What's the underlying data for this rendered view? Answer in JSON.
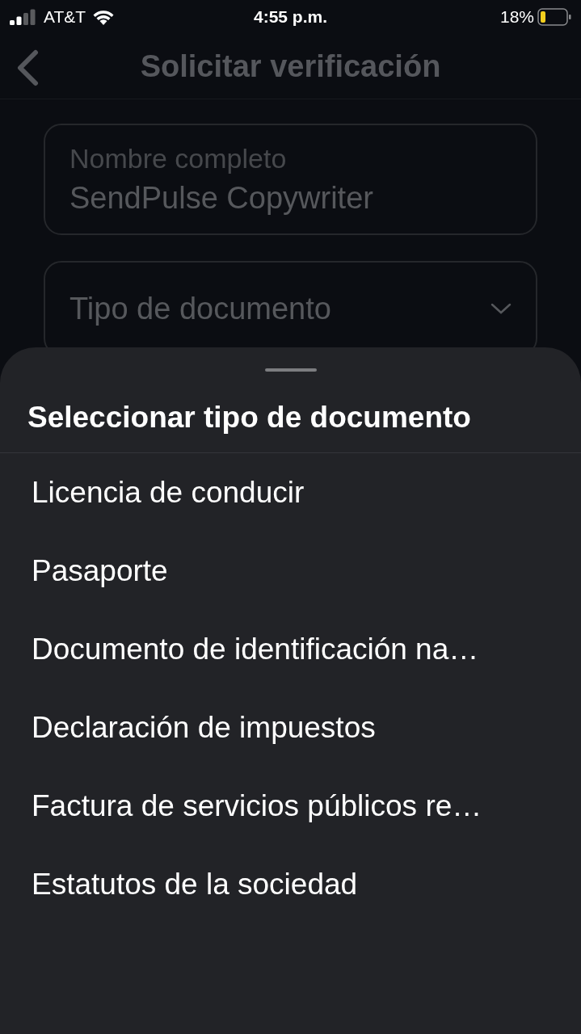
{
  "status_bar": {
    "carrier": "AT&T",
    "time": "4:55 p.m.",
    "battery": "18%"
  },
  "header": {
    "title": "Solicitar verificación"
  },
  "form": {
    "fields": [
      {
        "kind": "text",
        "label": "Nombre completo",
        "value": "SendPulse Copywriter"
      },
      {
        "kind": "select",
        "placeholder": "Tipo de documento"
      }
    ]
  },
  "sheet": {
    "title": "Seleccionar tipo de documento",
    "options": [
      {
        "label": "Licencia de conducir"
      },
      {
        "label": "Pasaporte"
      },
      {
        "label": "Documento de identificación na…"
      },
      {
        "label": "Declaración de impuestos"
      },
      {
        "label": "Factura de servicios públicos re…"
      },
      {
        "label": "Estatutos de la sociedad"
      }
    ]
  }
}
